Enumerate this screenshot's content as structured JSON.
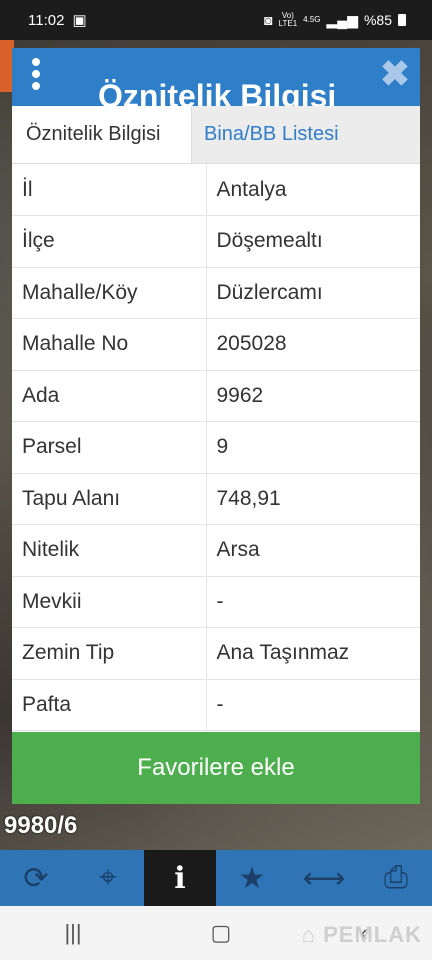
{
  "status_bar": {
    "time": "11:02",
    "network_top": "Vo)",
    "network_bottom": "LTE1",
    "net_type": "4.5G",
    "battery": "%85"
  },
  "map": {
    "parcel_label": "9980/6"
  },
  "modal": {
    "title": "Öznitelik Bilgisi",
    "tabs": [
      {
        "label": "Öznitelik Bilgisi",
        "active": true
      },
      {
        "label": "Bina/BB Listesi",
        "active": false
      }
    ],
    "rows": [
      {
        "key": "İl",
        "value": "Antalya"
      },
      {
        "key": "İlçe",
        "value": "Döşemealtı"
      },
      {
        "key": "Mahalle/Köy",
        "value": "Düzlercamı"
      },
      {
        "key": "Mahalle No",
        "value": "205028"
      },
      {
        "key": "Ada",
        "value": "9962"
      },
      {
        "key": "Parsel",
        "value": "9"
      },
      {
        "key": "Tapu Alanı",
        "value": "748,91"
      },
      {
        "key": "Nitelik",
        "value": "Arsa"
      },
      {
        "key": "Mevkii",
        "value": "-"
      },
      {
        "key": "Zemin Tip",
        "value": "Ana Taşınmaz"
      },
      {
        "key": "Pafta",
        "value": "-"
      }
    ],
    "favorite_button": "Favorilere ekle"
  },
  "toolbar": {
    "items": [
      {
        "icon": "refresh-icon"
      },
      {
        "icon": "crosshair-icon"
      },
      {
        "icon": "info-icon",
        "active": true
      },
      {
        "icon": "star-icon"
      },
      {
        "icon": "arrows-horizontal-icon"
      },
      {
        "icon": "printer-icon"
      }
    ]
  },
  "watermark": "EMLAK",
  "colors": {
    "header": "#2f7ec8",
    "button": "#4cae4c",
    "toolbar": "#2f74b5"
  }
}
